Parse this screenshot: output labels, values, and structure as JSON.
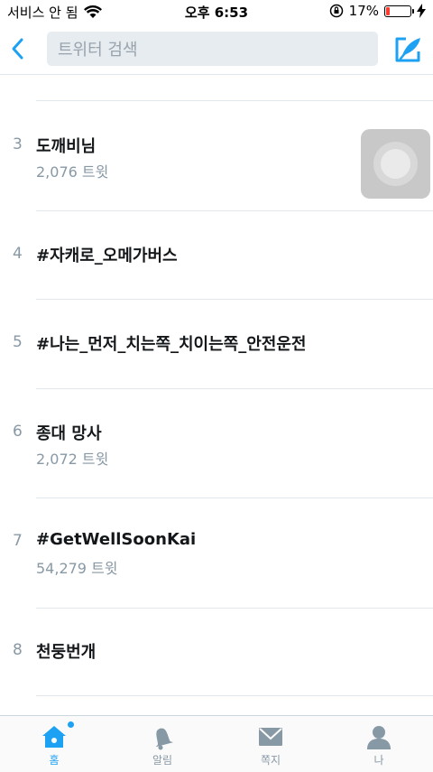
{
  "status_bar": {
    "carrier": "서비스 안 됨",
    "time": "오후 6:53",
    "battery_percent": "17%",
    "battery_level": 0.17
  },
  "nav": {
    "search_placeholder": "트위터 검색"
  },
  "trends": [
    {
      "rank": "3",
      "name": "도깨비님",
      "count": "2,076 트윗"
    },
    {
      "rank": "4",
      "name": "#자캐로_오메가버스",
      "count": ""
    },
    {
      "rank": "5",
      "name": "#나는_먼저_치는쪽_치이는쪽_안전운전",
      "count": ""
    },
    {
      "rank": "6",
      "name": "종대 망사",
      "count": "2,072 트윗"
    },
    {
      "rank": "7",
      "name": "#GetWellSoonKai",
      "count": "54,279 트윗"
    },
    {
      "rank": "8",
      "name": "천둥번개",
      "count": ""
    }
  ],
  "tabs": [
    {
      "label": "홈"
    },
    {
      "label": "알림"
    },
    {
      "label": "쪽지"
    },
    {
      "label": "나"
    }
  ],
  "colors": {
    "accent": "#1da1f2",
    "icon_gray": "#8899a6",
    "battery_low": "#ff3b30"
  }
}
